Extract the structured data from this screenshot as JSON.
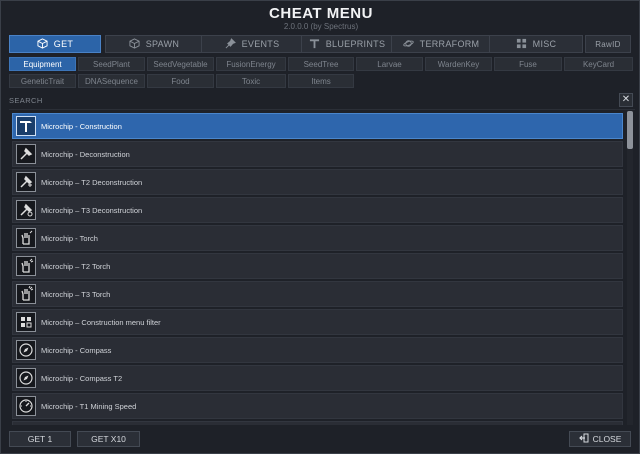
{
  "title": "CHEAT MENU",
  "subtitle": "2.0.0.0  (by Spectrus)",
  "tabs": [
    {
      "label": "GET",
      "icon": "cube-icon",
      "active": true
    },
    {
      "label": "SPAWN",
      "icon": "box-outline-icon",
      "active": false
    },
    {
      "label": "EVENTS",
      "icon": "pin-icon",
      "active": false
    },
    {
      "label": "BLUEPRINTS",
      "icon": "t-beam-icon",
      "active": false
    },
    {
      "label": "TERRAFORM",
      "icon": "planet-icon",
      "active": false
    },
    {
      "label": "MISC",
      "icon": "grid-icon",
      "active": false
    },
    {
      "label": "RawID",
      "icon": "",
      "active": false
    }
  ],
  "subtabs": [
    [
      "Equipment",
      "SeedPlant",
      "SeedVegetable",
      "FusionEnergy",
      "SeedTree",
      "Larvae",
      "WardenKey",
      "Fuse",
      "KeyCard"
    ],
    [
      "GeneticTrait",
      "DNASequence",
      "Food",
      "Toxic",
      "Items"
    ]
  ],
  "active_subtab": "Equipment",
  "search": {
    "label": "SEARCH",
    "value": "",
    "clear": "✕"
  },
  "items": [
    {
      "label": "Microchip - Construction",
      "icon": "hammer-icon",
      "selected": true
    },
    {
      "label": "Microchip - Deconstruction",
      "icon": "hammer-icon",
      "selected": false
    },
    {
      "label": "Microchip – T2 Deconstruction",
      "icon": "hammer-icon",
      "selected": false
    },
    {
      "label": "Microchip – T3 Deconstruction",
      "icon": "hammer-icon",
      "selected": false
    },
    {
      "label": "Microchip - Torch",
      "icon": "hand-torch-icon",
      "selected": false
    },
    {
      "label": "Microchip – T2 Torch",
      "icon": "hand-torch-icon",
      "selected": false
    },
    {
      "label": "Microchip – T3 Torch",
      "icon": "hand-torch-icon",
      "selected": false
    },
    {
      "label": "Microchip – Construction menu filter",
      "icon": "filter-blocks-icon",
      "selected": false
    },
    {
      "label": "Microchip - Compass",
      "icon": "compass-icon",
      "selected": false
    },
    {
      "label": "Microchip - Compass T2",
      "icon": "compass-icon",
      "selected": false
    },
    {
      "label": "Microchip - T1 Mining Speed",
      "icon": "gauge-icon",
      "selected": false
    }
  ],
  "scroll": {
    "position": 0.0
  },
  "buttons": {
    "get1": "GET 1",
    "get10": "GET X10",
    "close": "CLOSE"
  },
  "colors": {
    "accent": "#2c64a8",
    "background": "#1e2128",
    "row": "#2a2d35"
  }
}
